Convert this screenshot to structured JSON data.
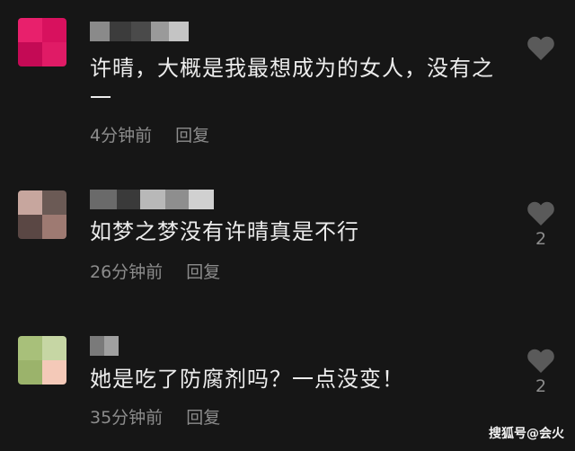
{
  "comments": [
    {
      "text": "许晴，大概是我最想成为的女人，没有之一",
      "time": "4分钟前",
      "reply_label": "回复",
      "like_count": "",
      "avatar_colors": [
        "#e8206c",
        "#d8115e",
        "#c40a55",
        "#e01b66"
      ]
    },
    {
      "text": "如梦之梦没有许晴真是不行",
      "time": "26分钟前",
      "reply_label": "回复",
      "like_count": "2",
      "avatar_colors": [
        "#c7a69e",
        "#6b5a55",
        "#5a4744",
        "#9e7a72"
      ]
    },
    {
      "text": "她是吃了防腐剂吗？一点没变！",
      "time": "35分钟前",
      "reply_label": "回复",
      "like_count": "2",
      "avatar_colors": [
        "#a8c07a",
        "#c6d6a4",
        "#9bb36b",
        "#f4c9b8"
      ]
    }
  ],
  "watermark": "搜狐号@会火",
  "colors": {
    "background": "#161616",
    "text": "#ececec",
    "meta": "#8c8c8c",
    "heart": "#5a5a5a"
  },
  "icons": {
    "like": "heart-icon"
  }
}
